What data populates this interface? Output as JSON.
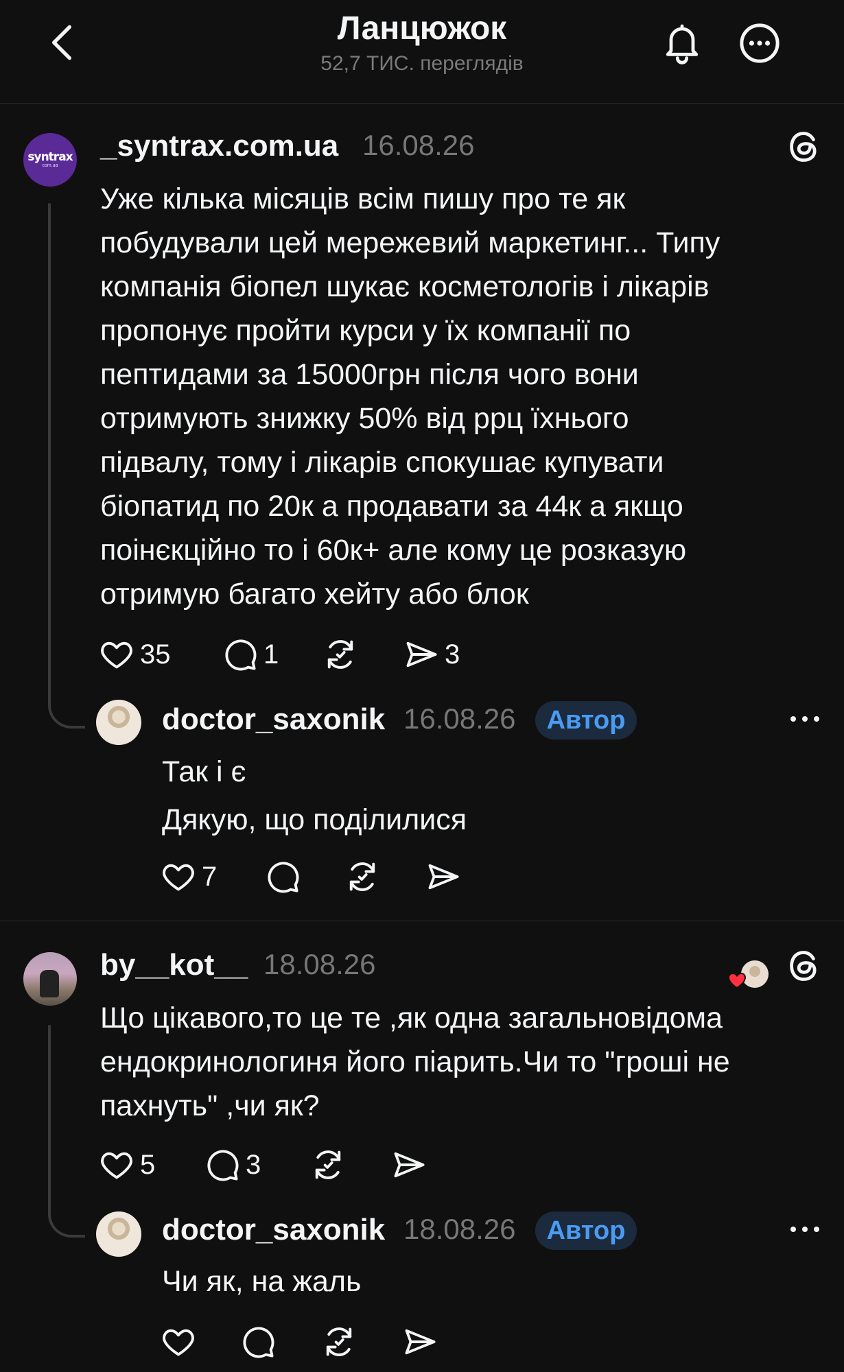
{
  "header": {
    "title": "Ланцюжок",
    "subtitle": "52,7 ТИС. переглядів"
  },
  "posts": [
    {
      "username": "_syntrax.com.ua",
      "date": "16.08.26",
      "avatar_text": "syntrax",
      "avatar_subtext": "com.ua",
      "lines": [
        "Уже кілька місяців всім пишу про те як",
        "побудували цей мережевий маркетинг... Типу",
        "компанія біопел шукає косметологів і лікарів",
        "пропонує пройти курси у їх компанії по",
        "пептидами за 15000грн після чого вони",
        "отримують знижку 50% від ррц їхнього",
        "підвалу, тому і лікарів спокушає купувати",
        "біопатид по 20к а продавати за 44к а якщо",
        "поінєкційно то і 60к+ але кому це розказую",
        "отримую багато хейту або блок"
      ],
      "likes": "35",
      "replies": "1",
      "reposts": "",
      "shares": "3"
    },
    {
      "username": "doctor_saxonik",
      "date": "16.08.26",
      "badge": "Автор",
      "lines": [
        "Так і є",
        "Дякую, що поділилися"
      ],
      "likes": "7",
      "replies": "",
      "reposts": "",
      "shares": ""
    },
    {
      "username": "by__kot__",
      "date": "18.08.26",
      "lines": [
        "Що цікавого,то це те ,як одна загальновідома",
        "ендокринологиня його піарить.Чи то \"гроші не",
        "пахнуть\" ,чи як?"
      ],
      "likes": "5",
      "replies": "3",
      "reposts": "",
      "shares": ""
    },
    {
      "username": "doctor_saxonik",
      "date": "18.08.26",
      "badge": "Автор",
      "lines": [
        "Чи як, на жаль"
      ],
      "likes": "",
      "replies": "",
      "reposts": "",
      "shares": ""
    }
  ],
  "icons": {
    "back": "chevron-left-icon",
    "bell": "bell-icon",
    "more": "more-circle-icon",
    "threads": "threads-logo-icon",
    "like": "heart-icon",
    "reply": "comment-icon",
    "repost": "repost-icon",
    "share": "send-icon",
    "liked_by_author": "heart-with-avatar-icon"
  },
  "colors": {
    "background": "#101010",
    "text": "#f3f5f7",
    "muted": "#777777",
    "badge_text": "#4a9bf2",
    "badge_bg": "#1b2a3d",
    "like_red": "#ff3040"
  }
}
